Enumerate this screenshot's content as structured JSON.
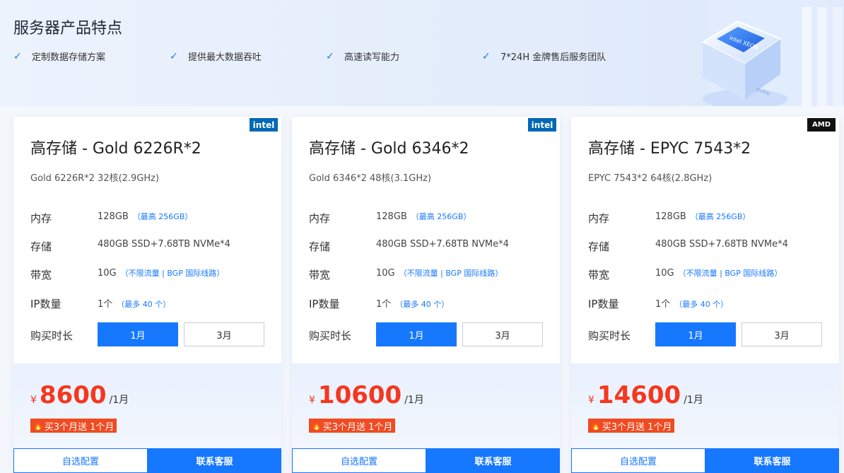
{
  "banner": {
    "title": "服务器产品特点",
    "features": [
      "定制数据存储方案",
      "提供最大数据吞吐",
      "高速读写能力",
      "7*24H 金牌售后服务团队"
    ],
    "chip_label": "intel XEON"
  },
  "labels": {
    "memory": "内存",
    "storage": "存储",
    "bandwidth": "带宽",
    "ip_count": "IP数量",
    "duration": "购买时长",
    "config_button": "自选配置",
    "contact_button": "联系客服"
  },
  "cards": [
    {
      "brand": "intel",
      "title": "高存储 - Gold 6226R*2",
      "subtitle": "Gold 6226R*2 32核(2.9GHz)",
      "memory": "128GB",
      "memory_note": "（最高 256GB）",
      "storage": "480GB SSD+7.68TB NVMe*4",
      "bandwidth": "10G",
      "bandwidth_note": "（不限流量 | BGP 国际线路）",
      "ip": "1个",
      "ip_note": "（最多 40 个）",
      "month_1": "1月",
      "month_3": "3月",
      "currency": "¥",
      "price": "8600",
      "price_unit": "/1月",
      "promo": "买3个月送 1个月"
    },
    {
      "brand": "intel",
      "title": "高存储 - Gold 6346*2",
      "subtitle": "Gold 6346*2 48核(3.1GHz)",
      "memory": "128GB",
      "memory_note": "（最高 256GB）",
      "storage": "480GB SSD+7.68TB NVMe*4",
      "bandwidth": "10G",
      "bandwidth_note": "（不限流量 | BGP 国际线路）",
      "ip": "1个",
      "ip_note": "（最多 40 个）",
      "month_1": "1月",
      "month_3": "3月",
      "currency": "¥",
      "price": "10600",
      "price_unit": "/1月",
      "promo": "买3个月送 1个月"
    },
    {
      "brand": "AMD",
      "title": "高存储 - EPYC 7543*2",
      "subtitle": "EPYC 7543*2 64核(2.8GHz)",
      "memory": "128GB",
      "memory_note": "（最高 256GB）",
      "storage": "480GB SSD+7.68TB NVMe*4",
      "bandwidth": "10G",
      "bandwidth_note": "（不限流量 | BGP 国际线路）",
      "ip": "1个",
      "ip_note": "（最多 40 个）",
      "month_1": "1月",
      "month_3": "3月",
      "currency": "¥",
      "price": "14600",
      "price_unit": "/1月",
      "promo": "买3个月送 1个月"
    }
  ],
  "colors": {
    "accent": "#1677ff",
    "price": "#f5371f",
    "promo_bg": "#f04b22"
  }
}
